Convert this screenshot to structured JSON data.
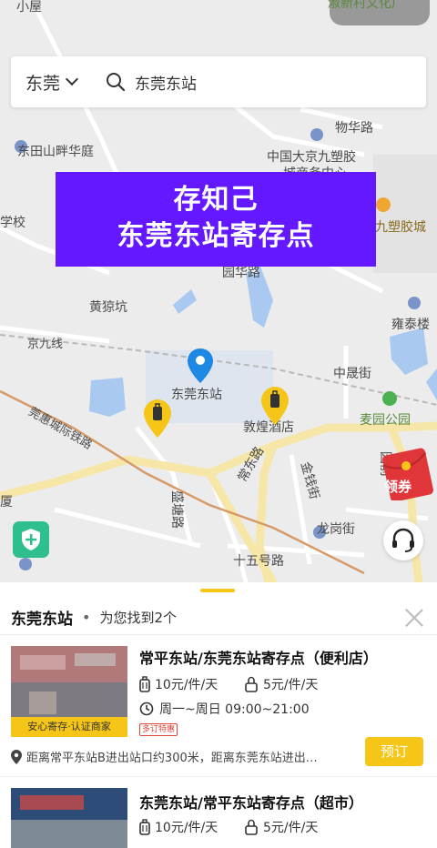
{
  "search": {
    "city": "东莞",
    "query": "东莞东站"
  },
  "banner": {
    "line1": "存知己",
    "line2": "东莞东站寄存点"
  },
  "map_labels": {
    "xiaowu": "小屋",
    "xinyuan": "淑新村文化广",
    "dongtian": "东田山畔华庭",
    "wuhua": "物华路",
    "zhongguo1": "中国大京九塑胶",
    "zhongguo2": "城商务中心",
    "xuexiao": "学校",
    "jiusujiao": "九塑胶城",
    "yuanhua": "园华路",
    "huanglaokeng": "黄猄坑",
    "yongtai": "雍泰楼",
    "jingjiu": "京九线",
    "dongguandongzhan": "东莞东站",
    "zhongsheng": "中晟街",
    "dunhuang": "敦煌酒店",
    "maiyuan": "麦园公园",
    "guanhui": "莞惠城际铁路",
    "changdong": "常东路",
    "jinqian": "金钱街",
    "shengtang": "盛塘路",
    "longgang": "龙岗街",
    "shiwuhao": "十五号路",
    "sha": "厦",
    "yuanqian": "园前"
  },
  "coupon_label": "领券",
  "sheet": {
    "title": "东莞东站",
    "dot": "•",
    "count_text": "为您找到2个"
  },
  "results": [
    {
      "title": "常平东站/东莞东站寄存点（便利店）",
      "price_bag": "10元/件/天",
      "price_lock": "5元/件/天",
      "hours": "周一~周日 09:00~21:00",
      "tag": "多订特惠",
      "badge": "安心寄存·认证商家",
      "address": "距离常平东站B进出站口约300米，距离东莞东站进出…",
      "book": "预订"
    },
    {
      "title": "东莞东站/常平东站寄存点（超市）",
      "price_bag": "10元/件/天",
      "price_lock": "5元/件/天"
    }
  ],
  "colors": {
    "accent": "#f5c518",
    "banner": "#6418ff",
    "shield": "#2fbf8e",
    "coupon": "#e0363a",
    "pin": "#1e88e5"
  },
  "icons": [
    "chevron-down-icon",
    "search-icon",
    "location-pin-icon",
    "luggage-pin-icon",
    "shield-plus-icon",
    "headset-icon",
    "red-packet-icon",
    "close-icon",
    "suitcase-icon",
    "lock-icon",
    "clock-icon",
    "map-marker-icon"
  ]
}
